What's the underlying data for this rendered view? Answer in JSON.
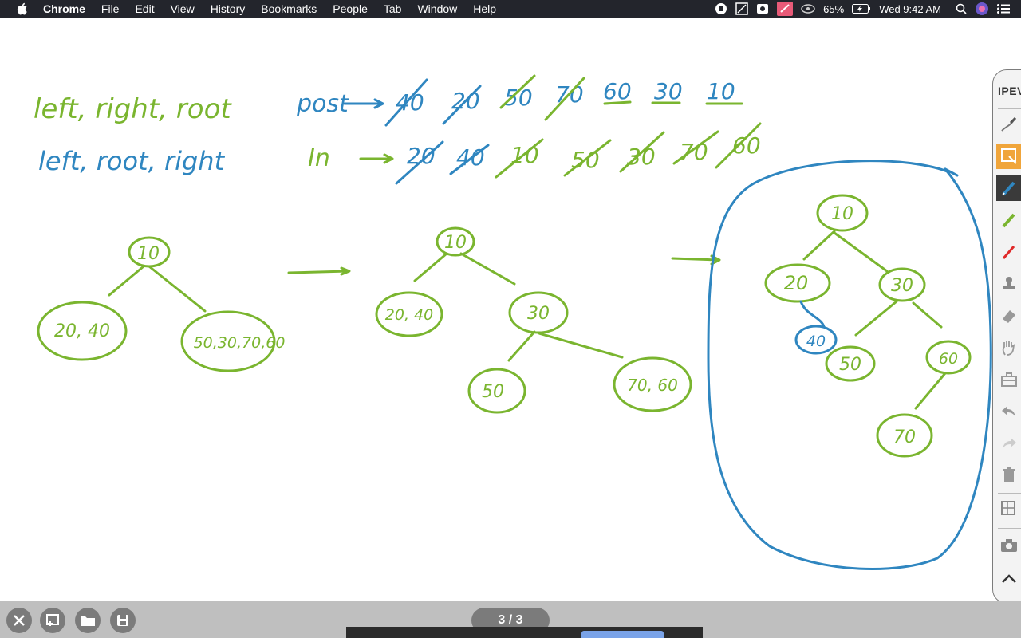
{
  "menubar": {
    "app_name": "Chrome",
    "menus": [
      "File",
      "Edit",
      "View",
      "History",
      "Bookmarks",
      "People",
      "Tab",
      "Window",
      "Help"
    ],
    "battery": "65%",
    "clock": "Wed 9:42 AM"
  },
  "palette": {
    "brand": "IPEVO"
  },
  "bottombar": {
    "page_indicator": "3 / 3"
  },
  "colors": {
    "green_ink": "#7ab52f",
    "blue_ink": "#2f86c0",
    "menubar_bg": "#23252c",
    "bottombar_bg": "#bfbfbf",
    "palette_active": "#f0a53b"
  },
  "whiteboard": {
    "line1_rule": "left, right, root",
    "line1_label": "post",
    "line1_seq": [
      "40",
      "20",
      "50",
      "70",
      "60",
      "30",
      "10"
    ],
    "line2_rule": "left, root, right",
    "line2_label": "In",
    "line2_seq": [
      "20",
      "40",
      "10",
      "50",
      "30",
      "70",
      "60"
    ],
    "tree1": {
      "root": "10",
      "left": "20, 40",
      "right": "50,30,70,60"
    },
    "tree2": {
      "root": "10",
      "left": "20, 40",
      "right": "30",
      "right_left": "50",
      "right_right": "70, 60"
    },
    "tree3": {
      "root": "10",
      "n20": "20",
      "n30": "30",
      "n40": "40",
      "n50": "50",
      "n60": "60",
      "n70": "70"
    }
  }
}
